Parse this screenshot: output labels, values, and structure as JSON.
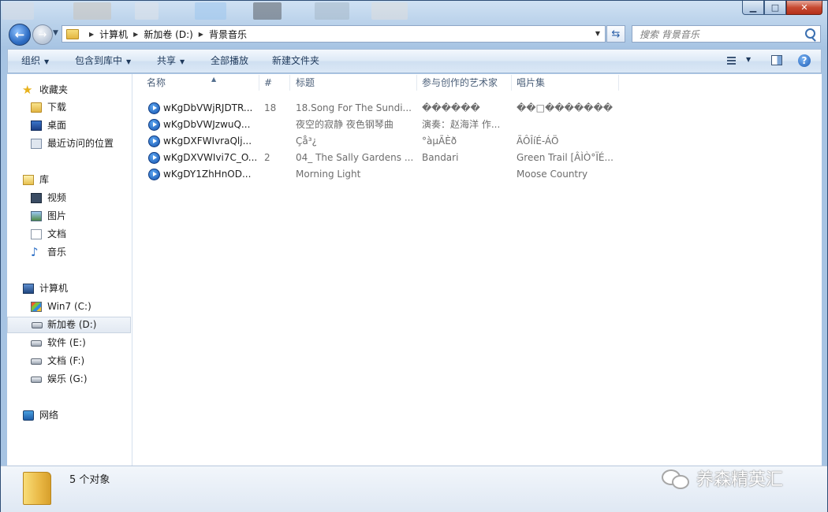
{
  "address": {
    "crumbs": [
      "计算机",
      "新加卷 (D:)",
      "背景音乐"
    ],
    "search_placeholder": "搜索 背景音乐"
  },
  "toolbar": {
    "organize": "组织",
    "include_in_library": "包含到库中",
    "share": "共享",
    "play_all": "全部播放",
    "new_folder": "新建文件夹"
  },
  "nav": {
    "favorites": "收藏夹",
    "downloads": "下载",
    "desktop": "桌面",
    "recent": "最近访问的位置",
    "libraries": "库",
    "videos": "视频",
    "pictures": "图片",
    "documents": "文档",
    "music": "音乐",
    "computer": "计算机",
    "drives": [
      "Win7 (C:)",
      "新加卷 (D:)",
      "软件 (E:)",
      "文档 (F:)",
      "娱乐 (G:)"
    ],
    "network": "网络"
  },
  "columns": [
    "名称",
    "#",
    "标题",
    "参与创作的艺术家",
    "唱片集"
  ],
  "files": [
    {
      "name": "wKgDbVWjRJDTR...",
      "num": "18",
      "title": "18.Song For The Sundi...",
      "artist": "������",
      "album": "��□�������"
    },
    {
      "name": "wKgDbVWJzwuQ...",
      "num": "",
      "title": "夜空的寂静 夜色钢琴曲",
      "artist": "演奏：赵海洋 作...",
      "album": ""
    },
    {
      "name": "wKgDXFWIvraQlj...",
      "num": "",
      "title": "Çå³¿",
      "artist": "°àµÃÈð",
      "album": "ÃÔÎíÉ-ÁÖ"
    },
    {
      "name": "wKgDXVWIvi7C_O...",
      "num": "2",
      "title": "04_ The Sally Gardens ...",
      "artist": "Bandari",
      "album": "Green Trail [ÂÌÒ°ÏÉ..."
    },
    {
      "name": "wKgDY1ZhHnOD...",
      "num": "",
      "title": "Morning Light",
      "artist": "",
      "album": "Moose Country"
    }
  ],
  "status": {
    "count": "5 个对象"
  },
  "watermark": "养森精英汇"
}
